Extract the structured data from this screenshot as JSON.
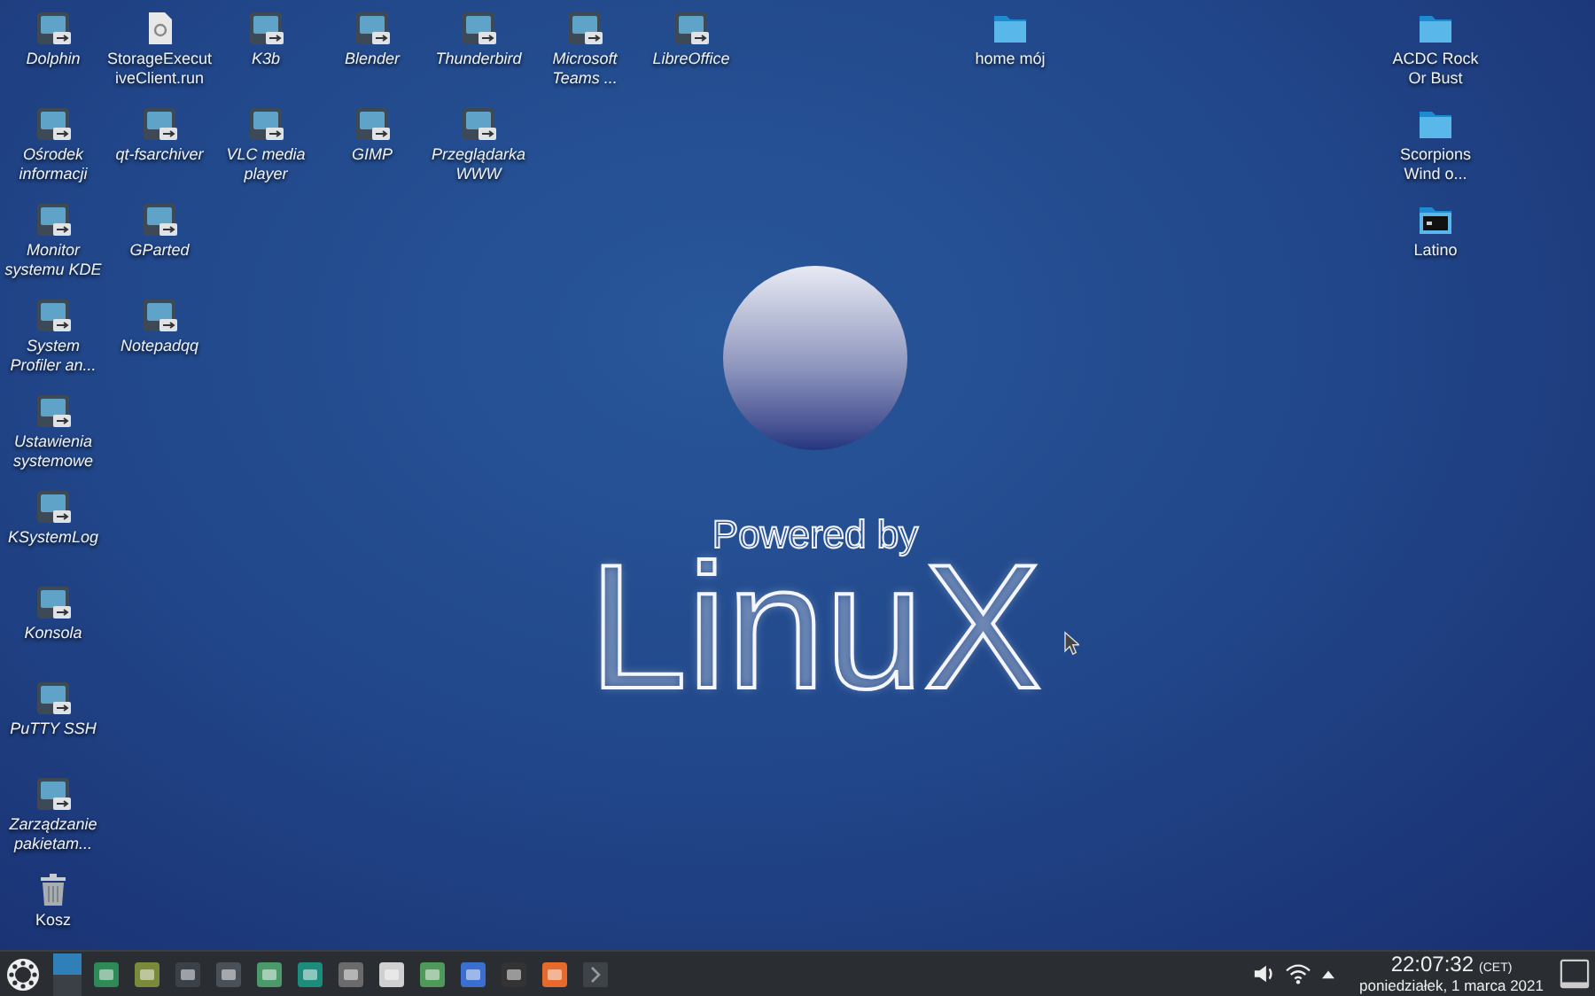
{
  "desktop": {
    "columns": [
      {
        "icons": [
          {
            "label": "Dolphin",
            "kind": "link"
          },
          {
            "label": "Ośrodek informacji",
            "kind": "link"
          },
          {
            "label": "Monitor systemu KDE",
            "kind": "link"
          },
          {
            "label": "System Profiler an...",
            "kind": "link"
          },
          {
            "label": "Ustawienia systemowe",
            "kind": "link"
          },
          {
            "label": "KSystemLog",
            "kind": "link"
          },
          {
            "label": "Konsola",
            "kind": "link"
          },
          {
            "label": "PuTTY SSH",
            "kind": "link"
          },
          {
            "label": "Zarządzanie pakietam...",
            "kind": "link"
          },
          {
            "label": "Kosz",
            "kind": "trash"
          }
        ]
      },
      {
        "icons": [
          {
            "label": "StorageExecutiveClient.run",
            "kind": "file"
          },
          {
            "label": "qt-fsarchiver",
            "kind": "link"
          },
          {
            "label": "GParted",
            "kind": "link"
          },
          {
            "label": "Notepadqq",
            "kind": "link"
          }
        ]
      },
      {
        "icons": [
          {
            "label": "K3b",
            "kind": "link"
          },
          {
            "label": "VLC media player",
            "kind": "link"
          }
        ]
      },
      {
        "icons": [
          {
            "label": "Blender",
            "kind": "link"
          },
          {
            "label": "GIMP",
            "kind": "link"
          }
        ]
      },
      {
        "icons": [
          {
            "label": "Thunderbird",
            "kind": "link"
          },
          {
            "label": "Przeglądarka WWW",
            "kind": "link"
          }
        ]
      },
      {
        "icons": [
          {
            "label": "Microsoft Teams ...",
            "kind": "link"
          }
        ]
      },
      {
        "icons": [
          {
            "label": "LibreOffice",
            "kind": "link"
          }
        ]
      },
      {
        "icons": [
          {
            "label": "home mój",
            "kind": "folder"
          }
        ]
      },
      {
        "icons": [
          {
            "label": "ACDC Rock Or Bust",
            "kind": "folder"
          },
          {
            "label": "Scorpions Wind o...",
            "kind": "folder"
          },
          {
            "label": "Latino",
            "kind": "image-folder"
          }
        ]
      }
    ]
  },
  "wallpaper": {
    "tagline": "Powered by",
    "logo": "LinuX"
  },
  "taskbar": {
    "desktops": [
      {
        "selected": true
      },
      {
        "selected": false
      }
    ],
    "clock": {
      "time": "22:07:32",
      "zone": "(CET)",
      "date": "poniedziałek, 1 marca 2021"
    }
  }
}
